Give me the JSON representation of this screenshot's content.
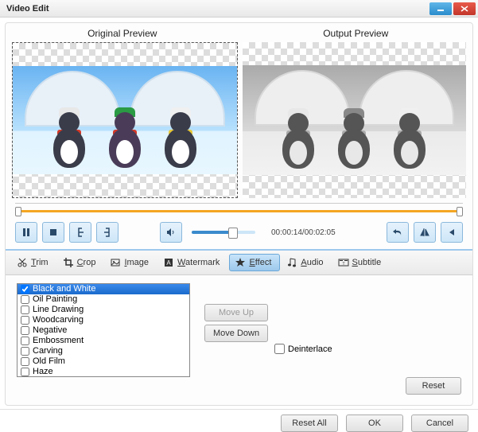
{
  "window": {
    "title": "Video Edit"
  },
  "previews": {
    "original": "Original Preview",
    "output": "Output Preview"
  },
  "playback": {
    "time_display": "00:00:14/00:02:05"
  },
  "tabs": {
    "trim": "Trim",
    "crop": "Crop",
    "image": "Image",
    "watermark": "Watermark",
    "effect": "Effect",
    "audio": "Audio",
    "subtitle": "Subtitle"
  },
  "effects": {
    "items": [
      {
        "label": "Black and White",
        "checked": true,
        "selected": true
      },
      {
        "label": "Oil Painting",
        "checked": false,
        "selected": false
      },
      {
        "label": "Line Drawing",
        "checked": false,
        "selected": false
      },
      {
        "label": "Woodcarving",
        "checked": false,
        "selected": false
      },
      {
        "label": "Negative",
        "checked": false,
        "selected": false
      },
      {
        "label": "Embossment",
        "checked": false,
        "selected": false
      },
      {
        "label": "Carving",
        "checked": false,
        "selected": false
      },
      {
        "label": "Old Film",
        "checked": false,
        "selected": false
      },
      {
        "label": "Haze",
        "checked": false,
        "selected": false
      }
    ]
  },
  "buttons": {
    "move_up": "Move Up",
    "move_down": "Move Down",
    "deinterlace": "Deinterlace",
    "reset": "Reset",
    "reset_all": "Reset All",
    "ok": "OK",
    "cancel": "Cancel"
  }
}
